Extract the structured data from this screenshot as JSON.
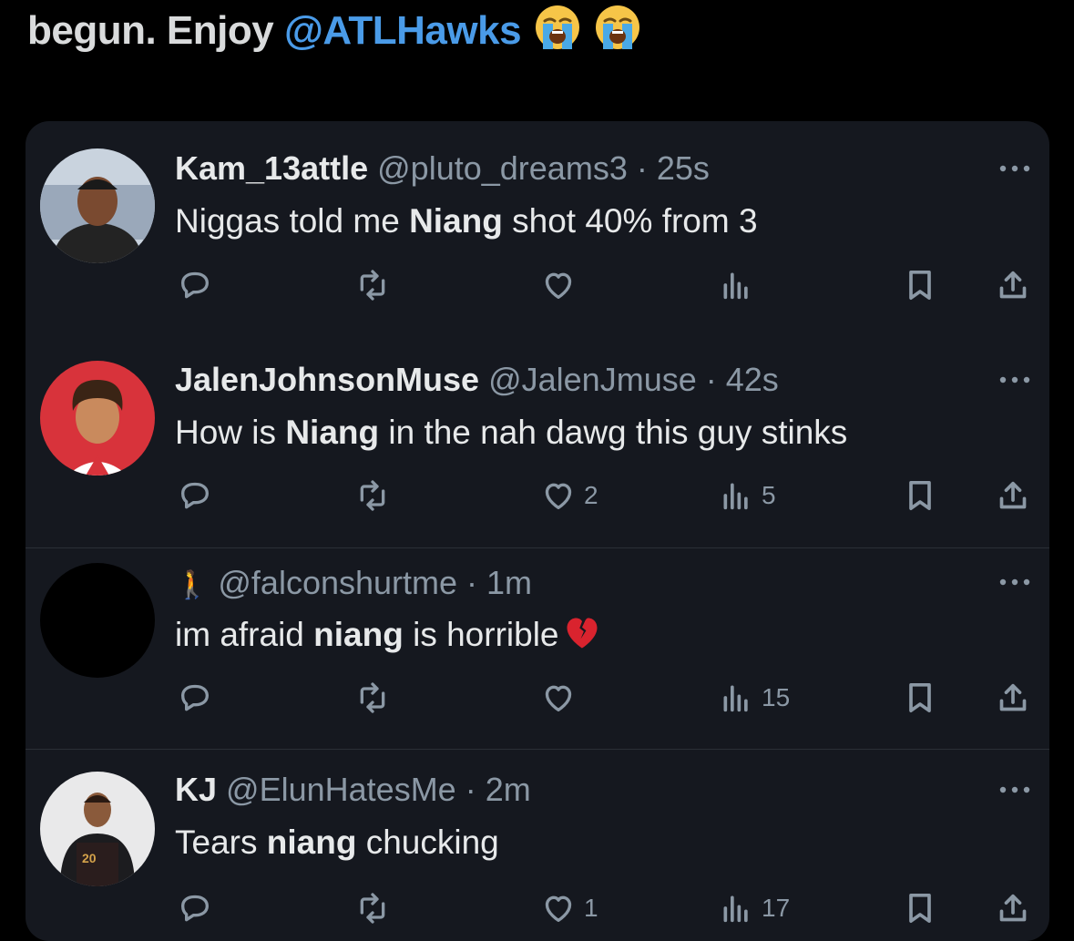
{
  "header": {
    "text": "begun. Enjoy ",
    "mention": "@ATLHawks",
    "emojis": [
      "loudly-crying-face-emoji",
      "loudly-crying-face-emoji"
    ]
  },
  "tweets": [
    {
      "display_name": "Kam_13attle",
      "handle": "@pluto_dreams3",
      "time": "25s",
      "text_before": "Niggas told me ",
      "highlight": "Niang",
      "text_after": " shot 40% from 3",
      "likes": "",
      "views": ""
    },
    {
      "display_name": "JalenJohnsonMuse",
      "handle": "@JalenJmuse",
      "time": "42s",
      "text_before": "How is ",
      "highlight": "Niang",
      "text_after": " in the nah dawg this guy stinks",
      "likes": "2",
      "views": "5"
    },
    {
      "display_name": "🚶",
      "handle": "@falconshurtme",
      "time": "1m",
      "text_before": "im afraid ",
      "highlight": "niang",
      "text_after": " is horrible",
      "emoji": "broken-heart-emoji",
      "likes": "",
      "views": "15"
    },
    {
      "display_name": "KJ",
      "handle": "@ElunHatesMe",
      "time": "2m",
      "text_before": "Tears ",
      "highlight": "niang",
      "text_after": " chucking",
      "likes": "1",
      "views": "17"
    }
  ],
  "separator": "·",
  "colors": {
    "background": "#000000",
    "card": "#15181f",
    "mention": "#4a9be8",
    "muted": "#8b98a5",
    "text": "#e7e9ea"
  }
}
